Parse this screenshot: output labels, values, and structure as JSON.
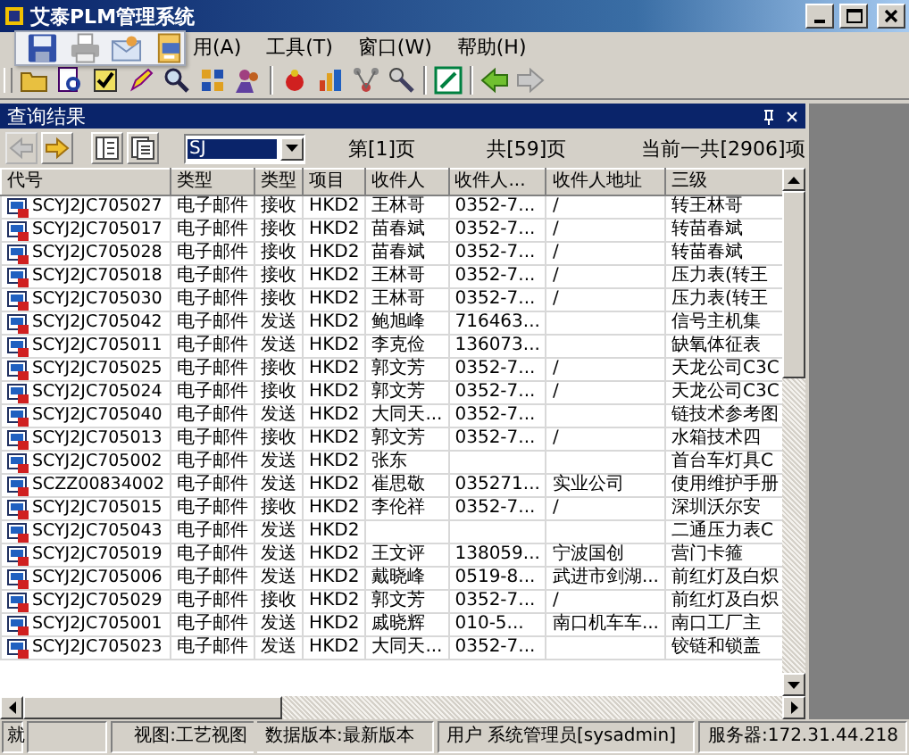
{
  "window": {
    "title": "艾泰PLM管理系统"
  },
  "menu": [
    {
      "label": "用(A)"
    },
    {
      "label": "工具(T)"
    },
    {
      "label": "窗口(W)"
    },
    {
      "label": "帮助(H)"
    }
  ],
  "panel": {
    "title": "查询结果"
  },
  "pager": {
    "nav": [
      {
        "disabled": true
      },
      {
        "disabled": false
      }
    ],
    "combo_value": "SJ",
    "page": "第[1]页",
    "pages": "共[59]页",
    "total": "当前一共[2906]项"
  },
  "table": {
    "columns": [
      "代号",
      "类型",
      "类型",
      "项目",
      "收件人",
      "收件人...",
      "收件人地址",
      "三级"
    ],
    "rows": [
      [
        "SCYJ2JC705027",
        "电子邮件",
        "接收",
        "HKD2",
        "王林哥",
        "0352-7...",
        "/",
        "转王林哥"
      ],
      [
        "SCYJ2JC705017",
        "电子邮件",
        "接收",
        "HKD2",
        "苗春斌",
        "0352-7...",
        "/",
        "转苗春斌"
      ],
      [
        "SCYJ2JC705028",
        "电子邮件",
        "接收",
        "HKD2",
        "苗春斌",
        "0352-7...",
        "/",
        "转苗春斌"
      ],
      [
        "SCYJ2JC705018",
        "电子邮件",
        "接收",
        "HKD2",
        "王林哥",
        "0352-7...",
        "/",
        "压力表(转王"
      ],
      [
        "SCYJ2JC705030",
        "电子邮件",
        "接收",
        "HKD2",
        "王林哥",
        "0352-7...",
        "/",
        "压力表(转王"
      ],
      [
        "SCYJ2JC705042",
        "电子邮件",
        "发送",
        "HKD2",
        "鲍旭峰",
        "716463...",
        "",
        "信号主机集"
      ],
      [
        "SCYJ2JC705011",
        "电子邮件",
        "发送",
        "HKD2",
        "李克俭",
        "136073...",
        "",
        "缺氧体征表"
      ],
      [
        "SCYJ2JC705025",
        "电子邮件",
        "接收",
        "HKD2",
        "郭文芳",
        "0352-7...",
        "/",
        "天龙公司C3C"
      ],
      [
        "SCYJ2JC705024",
        "电子邮件",
        "接收",
        "HKD2",
        "郭文芳",
        "0352-7...",
        "/",
        "天龙公司C3C"
      ],
      [
        "SCYJ2JC705040",
        "电子邮件",
        "发送",
        "HKD2",
        "大同天...",
        "0352-7...",
        "",
        "链技术参考图"
      ],
      [
        "SCYJ2JC705013",
        "电子邮件",
        "接收",
        "HKD2",
        "郭文芳",
        "0352-7...",
        "/",
        "水箱技术四"
      ],
      [
        "SCYJ2JC705002",
        "电子邮件",
        "发送",
        "HKD2",
        "张东",
        "",
        "",
        "首台车灯具C"
      ],
      [
        "SCZZ00834002",
        "电子邮件",
        "发送",
        "HKD2",
        "崔思敬",
        "035271...",
        "实业公司",
        "使用维护手册"
      ],
      [
        "SCYJ2JC705015",
        "电子邮件",
        "接收",
        "HKD2",
        "李伦祥",
        "0352-7...",
        "/",
        "深圳沃尔安"
      ],
      [
        "SCYJ2JC705043",
        "电子邮件",
        "发送",
        "HKD2",
        "",
        "",
        "",
        "二通压力表C"
      ],
      [
        "SCYJ2JC705019",
        "电子邮件",
        "发送",
        "HKD2",
        "王文评",
        "138059...",
        "宁波国创",
        "营门卡箍"
      ],
      [
        "SCYJ2JC705006",
        "电子邮件",
        "发送",
        "HKD2",
        "戴晓峰",
        "0519-8...",
        "武进市剑湖...",
        "前红灯及白炽"
      ],
      [
        "SCYJ2JC705029",
        "电子邮件",
        "接收",
        "HKD2",
        "郭文芳",
        "0352-7...",
        "/",
        "前红灯及白炽"
      ],
      [
        "SCYJ2JC705001",
        "电子邮件",
        "发送",
        "HKD2",
        "戚晓辉",
        "010-5...",
        "南口机车车...",
        "南口工厂主"
      ],
      [
        "SCYJ2JC705023",
        "电子邮件",
        "发送",
        "HKD2",
        "大同天...",
        "0352-7...",
        "",
        "铰链和锁盖"
      ]
    ]
  },
  "status_bar": [
    "就",
    "视图:工艺视图",
    "数据版本:最新版本",
    "用户 系统管理员[sysadmin]",
    "服务器:172.31.44.218"
  ]
}
